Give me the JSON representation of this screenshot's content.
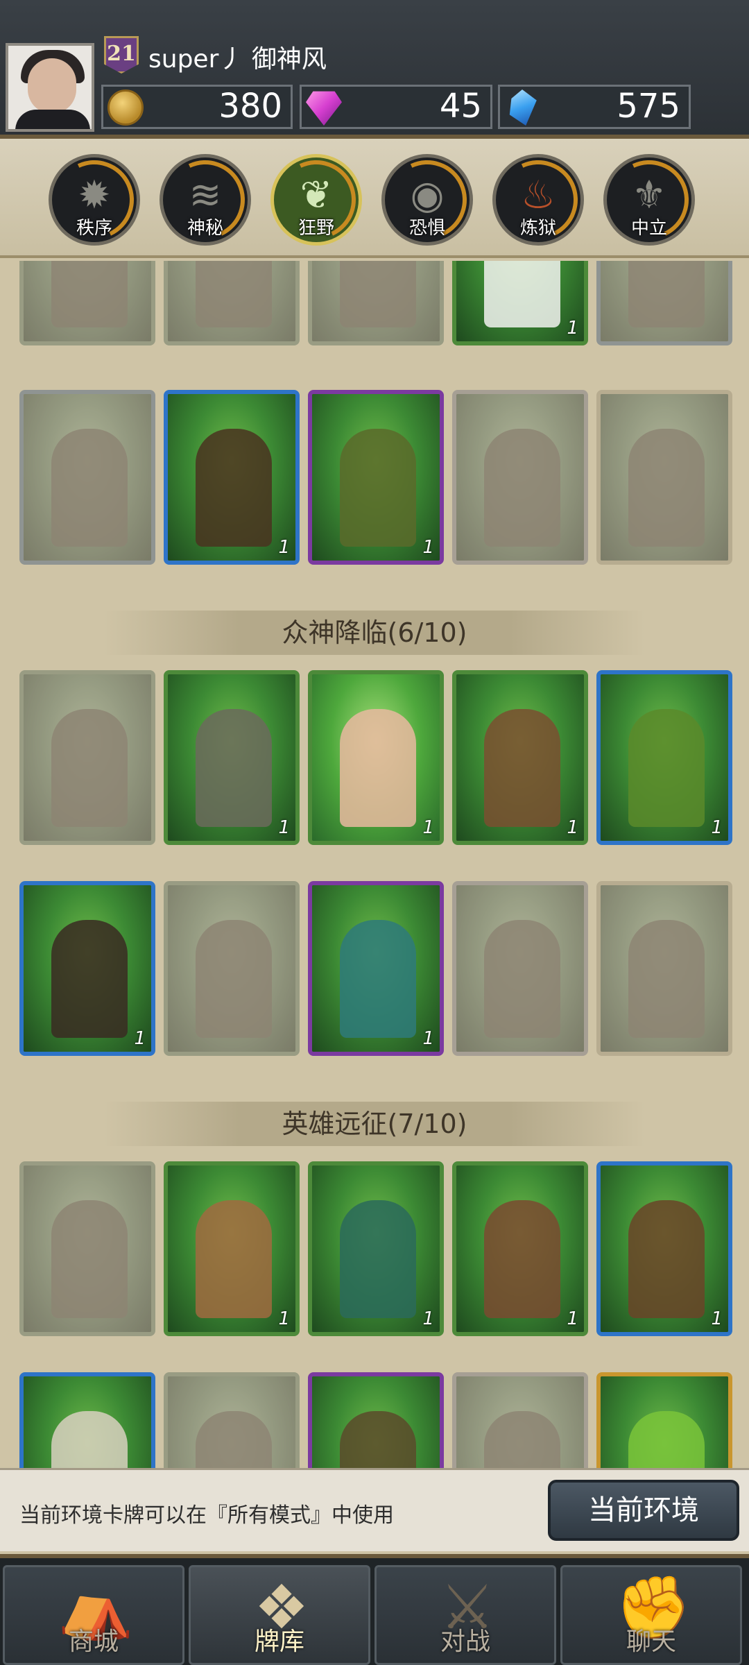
{
  "player": {
    "level": "21",
    "name": "super丿 御神风",
    "gold": "380",
    "gems": "45",
    "crystals": "575"
  },
  "factions": [
    {
      "label": "秩序",
      "icon": "sun-icon",
      "active": false
    },
    {
      "label": "神秘",
      "icon": "swirl-icon",
      "active": false
    },
    {
      "label": "狂野",
      "icon": "leaf-icon",
      "active": true
    },
    {
      "label": "恐惧",
      "icon": "eye-icon",
      "active": false
    },
    {
      "label": "炼狱",
      "icon": "flame-icon",
      "active": false
    },
    {
      "label": "中立",
      "icon": "crest-icon",
      "active": false
    }
  ],
  "sections": [
    {
      "title": "众神降临(6/10)"
    },
    {
      "title": "英雄远征(7/10)"
    }
  ],
  "card_count_label": "1",
  "info": {
    "text": "当前环境卡牌可以在『所有模式』中使用",
    "button_label": "当前环境"
  },
  "nav": [
    {
      "label": "商城",
      "icon": "shop-icon",
      "active": false
    },
    {
      "label": "牌库",
      "icon": "card-deck-icon",
      "active": true
    },
    {
      "label": "对战",
      "icon": "crossed-swords-icon",
      "active": false
    },
    {
      "label": "聊天",
      "icon": "chat-fist-icon",
      "active": false
    }
  ],
  "colors": {
    "accent_gold": "#c88a20",
    "wild_green": "#4d8a3a",
    "rare_blue": "#2e74c8",
    "epic_purple": "#7b3aa0",
    "legendary_gold": "#c9962e"
  }
}
